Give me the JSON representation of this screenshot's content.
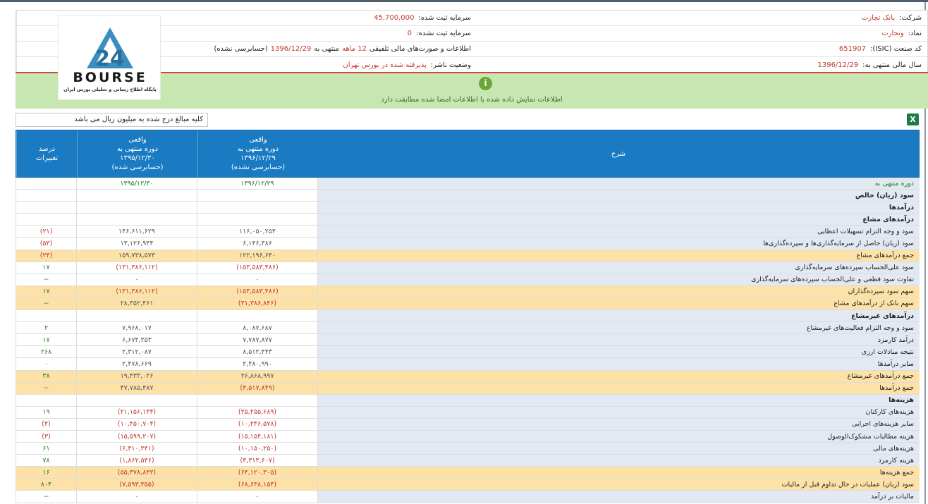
{
  "info": {
    "company_label": "شرکت:",
    "company_value": "بانک تجارت",
    "symbol_label": "نماد:",
    "symbol_value": "وتجارت",
    "isic_label": "کد صنعت (ISIC):",
    "isic_value": "651907",
    "fiscal_label": "سال مالی منتهی به:",
    "fiscal_value": "1396/12/29",
    "reg_capital_label": "سرمایه ثبت شده:",
    "reg_capital_value": "45,700,000",
    "unreg_capital_label": "سرمایه ثبت نشده:",
    "unreg_capital_value": "0",
    "statement_prefix": "اطلاعات و صورت‌های مالی تلفیقی",
    "statement_period": "12 ماهه",
    "statement_mid": "منتهی به",
    "statement_date": "1396/12/29",
    "statement_suffix": "(حسابرسی نشده)",
    "publisher_label": "وضعیت ناشر:",
    "publisher_value": "پذیرفته شده در بورس تهران"
  },
  "logo": {
    "text": "BOURSE",
    "subtitle": "پایگاه اطلاع رسانی و تحلیلی بورس ایران"
  },
  "notice": {
    "icon": "i",
    "message": "اطلاعات نمایش داده شده با اطلاعات امضا شده مطابقت دارد"
  },
  "units": "کلیه مبالغ درج شده به میلیون ریال می باشد",
  "excel_icon": "X",
  "table": {
    "headers": {
      "desc": "شرح",
      "col1": [
        "واقعی",
        "دوره منتهی به",
        "۱۳۹۶/۱۲/۲۹",
        "(حسابرسی نشده)"
      ],
      "col2": [
        "واقعی",
        "دوره منتهی به",
        "۱۳۹۵/۱۲/۳۰",
        "(حسابرسی شده)"
      ],
      "col3": [
        "درصد",
        "تغییرات"
      ]
    },
    "rows": [
      {
        "d": "دوره منتهی به",
        "a": "۱۳۹۶/۱۲/۲۹",
        "b": "۱۳۹۵/۱۲/۳۰",
        "p": "",
        "kind": "first"
      },
      {
        "d": "سود (زیان) خالص",
        "a": "",
        "b": "",
        "p": "",
        "kind": "hdr"
      },
      {
        "d": "درآمدها",
        "a": "",
        "b": "",
        "p": "",
        "kind": "hdr"
      },
      {
        "d": "درآمدهای مشاع",
        "a": "",
        "b": "",
        "p": "",
        "kind": "hdr"
      },
      {
        "d": "سود و وجه التزام تسهیلات اعطایی",
        "a": "۱۱۶,۰۵۰,۲۵۴",
        "b": "۱۴۶,۶۱۱,۶۲۹",
        "p": "(۲۱)",
        "kind": ""
      },
      {
        "d": "سود (زیان) حاصل از سرمایه‌گذاری‌ها و سپرده‌گذاری‌ها",
        "a": "۶,۱۴۶,۳۸۶",
        "b": "۱۳,۱۲۶,۹۴۴",
        "p": "(۵۳)",
        "kind": ""
      },
      {
        "d": "جمع درآمدهای مشاع",
        "a": "۱۲۲,۱۹۶,۶۴۰",
        "b": "۱۵۹,۷۳۸,۵۷۳",
        "p": "(۲۴)",
        "kind": "sum"
      },
      {
        "d": "سود علی‌الحساب سپرده‌های سرمایه‌گذاری",
        "a": "(۱۵۳,۵۸۳,۴۸۶)",
        "b": "(۱۳۱,۳۸۶,۱۱۲)",
        "p": "۱۷",
        "kind": ""
      },
      {
        "d": "تفاوت سود قطعی و علی‌الحساب سپرده‌های سرمایه‌گذاری",
        "a": "۰",
        "b": "۰",
        "p": "--",
        "kind": ""
      },
      {
        "d": "سهم سود سپرده‌گذاران",
        "a": "(۱۵۳,۵۸۳,۴۸۶)",
        "b": "(۱۳۱,۳۸۶,۱۱۲)",
        "p": "۱۷",
        "kind": "sum"
      },
      {
        "d": "سهم بانک از درآمدهای مشاع",
        "a": "(۳۱,۳۸۶,۸۴۶)",
        "b": "۲۸,۳۵۲,۴۶۱",
        "p": "--",
        "kind": "sum"
      },
      {
        "d": "درآمدهای غیرمشاع",
        "a": "",
        "b": "",
        "p": "",
        "kind": "hdr"
      },
      {
        "d": "سود و وجه التزام فعالیت‌های غیرمشاع",
        "a": "۸,۰۸۷,۶۸۷",
        "b": "۷,۹۶۸,۰۱۷",
        "p": "۲",
        "kind": ""
      },
      {
        "d": "درآمد کارمزد",
        "a": "۷,۷۸۷,۸۷۷",
        "b": "۶,۶۷۴,۲۵۳",
        "p": "۱۷",
        "kind": ""
      },
      {
        "d": "نتیجه مبادلات ارزی",
        "a": "۸,۵۱۲,۴۴۳",
        "b": "۲,۳۱۲,۰۸۷",
        "p": "۲۶۸",
        "kind": ""
      },
      {
        "d": "سایر درآمدها",
        "a": "۲,۴۸۰,۹۹۰",
        "b": "۲,۴۷۸,۶۶۹",
        "p": "۰",
        "kind": ""
      },
      {
        "d": "جمع درآمدهای غیرمشاع",
        "a": "۲۶,۸۶۸,۹۹۷",
        "b": "۱۹,۴۳۳,۰۲۶",
        "p": "۳۸",
        "kind": "sum"
      },
      {
        "d": "جمع درآمدها",
        "a": "(۴,۵۱۷,۸۴۹)",
        "b": "۴۷,۷۸۵,۴۸۷",
        "p": "--",
        "kind": "sum"
      },
      {
        "d": "هزینه‌ها",
        "a": "",
        "b": "",
        "p": "",
        "kind": "hdr"
      },
      {
        "d": "هزینه‌های کارکنان",
        "a": "(۲۵,۲۵۵,۶۸۹)",
        "b": "(۲۱,۱۵۶,۱۴۴)",
        "p": "۱۹",
        "kind": ""
      },
      {
        "d": "سایر هزینه‌های اجرایی",
        "a": "(۱۰,۲۴۶,۵۷۸)",
        "b": "(۱۰,۴۵۰,۷۰۴)",
        "p": "(۲)",
        "kind": ""
      },
      {
        "d": "هزینه مطالبات مشکوک‌الوصول",
        "a": "(۱۵,۱۵۴,۱۸۱)",
        "b": "(۱۵,۵۹۹,۲۰۷)",
        "p": "(۳)",
        "kind": ""
      },
      {
        "d": "هزینه‌های مالی",
        "a": "(۱۰,۱۵۰,۲۵۰)",
        "b": "(۶,۳۱۰,۲۴۱)",
        "p": "۶۱",
        "kind": ""
      },
      {
        "d": "هزینه کارمزد",
        "a": "(۳,۳۱۳,۶۰۷)",
        "b": "(۱,۸۶۲,۵۴۶)",
        "p": "۷۸",
        "kind": ""
      },
      {
        "d": "جمع هزینه‌ها",
        "a": "(۶۴,۱۲۰,۳۰۵)",
        "b": "(۵۵,۳۷۸,۸۴۲)",
        "p": "۱۶",
        "kind": "sum"
      },
      {
        "d": "سود (زیان) عملیات در حال تداوم قبل از مالیات",
        "a": "(۶۸,۶۳۸,۱۵۴)",
        "b": "(۷,۵۹۳,۳۵۵)",
        "p": "۸۰۴",
        "kind": "sum"
      },
      {
        "d": "مالیات بر درآمد",
        "a": "۰",
        "b": "۰",
        "p": "--",
        "kind": ""
      }
    ]
  }
}
